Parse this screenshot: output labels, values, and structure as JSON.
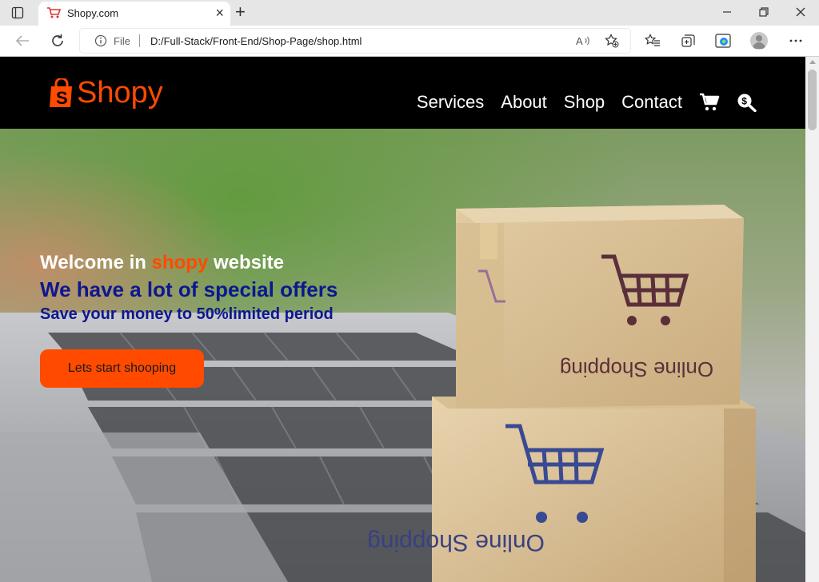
{
  "browser": {
    "tab_title": "Shopy.com",
    "file_label": "File",
    "url": "D:/Full-Stack/Front-End/Shop-Page/shop.html"
  },
  "site": {
    "logo_text": "Shopy",
    "nav": [
      "Services",
      "About",
      "Shop",
      "Contact"
    ],
    "icons": {
      "cart": "cart-icon",
      "search": "search-dollar-icon"
    }
  },
  "hero": {
    "welcome_prefix": "Welcome in ",
    "welcome_brand": "shopy",
    "welcome_suffix": " website",
    "offers": "We have a lot of special offers",
    "save": "Save your money to 50%limited period",
    "cta_label": "Lets start shooping",
    "box_label": "Online Shopping"
  },
  "colors": {
    "brand": "#ff4a00",
    "offer_text": "#0d1790",
    "header_bg": "#000000"
  }
}
